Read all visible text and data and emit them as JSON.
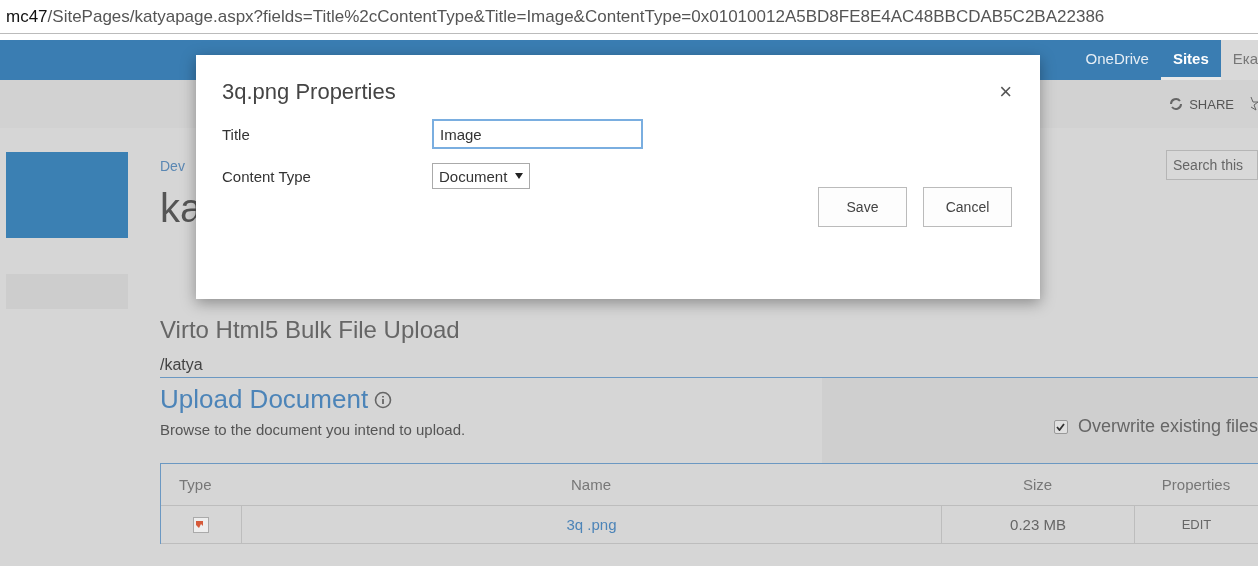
{
  "address_bar": {
    "host": "mc47",
    "path": "/SitePages/katyapage.aspx?fields=Title%2cContentType&Title=Image&ContentType=0x01010012A5BD8FE8E4AC48BBCDAB5C2BA22386"
  },
  "suite_bar": {
    "links": [
      {
        "label": "OneDrive",
        "selected": false
      },
      {
        "label": "Sites",
        "selected": true
      },
      {
        "label": "Ека",
        "selected": false
      }
    ]
  },
  "ribbon": {
    "share": "SHARE"
  },
  "page": {
    "breadcrumb": "Dev",
    "title": "ka",
    "search": {
      "placeholder": "Search this"
    }
  },
  "webpart": {
    "title": "Virto Html5 Bulk File Upload",
    "folder": "/katya",
    "upload_title": "Upload Document",
    "hint": "Browse to the document you intend to upload.",
    "overwrite": {
      "label": "Overwrite existing files",
      "checked": true
    }
  },
  "table": {
    "columns": [
      "Type",
      "Name",
      "Size",
      "Properties"
    ],
    "rows": [
      {
        "name": "3q .png",
        "size": "0.23 MB",
        "action": "EDIT"
      }
    ]
  },
  "dialog": {
    "title": "3q.png Properties",
    "close": "×",
    "fields": [
      {
        "kind": "text",
        "label": "Title",
        "value": "Image"
      },
      {
        "kind": "select",
        "label": "Content Type",
        "value": "Document"
      }
    ],
    "buttons": [
      "Save",
      "Cancel"
    ]
  }
}
